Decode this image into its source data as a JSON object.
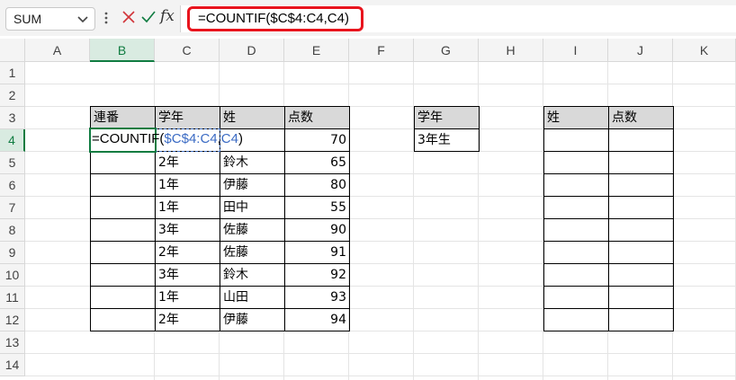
{
  "formula_bar": {
    "name_box": "SUM",
    "fx_label": "fx",
    "formula": "=COUNTIF($C$4:C4,C4)"
  },
  "columns": [
    "A",
    "B",
    "C",
    "D",
    "E",
    "F",
    "G",
    "H",
    "I",
    "J",
    "K"
  ],
  "rows": [
    "1",
    "2",
    "3",
    "4",
    "5",
    "6",
    "7",
    "8",
    "9",
    "10",
    "11",
    "12",
    "13",
    "14"
  ],
  "editing": {
    "prefix": "=COUNTIF(",
    "ref1": "$C$4:C4",
    "comma": ",",
    "ref2": "C4",
    "suffix": ")"
  },
  "main_table": {
    "headers": [
      "連番",
      "学年",
      "姓",
      "点数"
    ],
    "rows": [
      {
        "no": "",
        "grade": "",
        "name": "",
        "score": "70"
      },
      {
        "no": "",
        "grade": "2年",
        "name": "鈴木",
        "score": "65"
      },
      {
        "no": "",
        "grade": "1年",
        "name": "伊藤",
        "score": "80"
      },
      {
        "no": "",
        "grade": "1年",
        "name": "田中",
        "score": "55"
      },
      {
        "no": "",
        "grade": "3年",
        "name": "佐藤",
        "score": "90"
      },
      {
        "no": "",
        "grade": "2年",
        "name": "佐藤",
        "score": "91"
      },
      {
        "no": "",
        "grade": "3年",
        "name": "鈴木",
        "score": "92"
      },
      {
        "no": "",
        "grade": "1年",
        "name": "山田",
        "score": "93"
      },
      {
        "no": "",
        "grade": "2年",
        "name": "伊藤",
        "score": "94"
      }
    ]
  },
  "criteria_table": {
    "header": "学年",
    "value": "3年生"
  },
  "result_table": {
    "headers": [
      "姓",
      "点数"
    ],
    "row_count": 9
  },
  "colors": {
    "accent": "#107c41",
    "highlight_border": "#e8141d",
    "ref_blue": "#3b6bc4",
    "header_fill": "#d9d9d9"
  }
}
